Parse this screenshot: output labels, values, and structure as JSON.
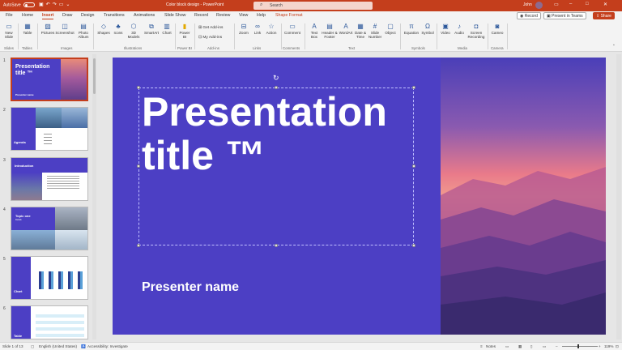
{
  "titlebar": {
    "autosave_label": "AutoSave",
    "autosave_state": "Off",
    "doc_title": "Color block design  -  PowerPoint",
    "search_placeholder": "Search",
    "user_name": "John"
  },
  "tabs": [
    "File",
    "Home",
    "Insert",
    "Draw",
    "Design",
    "Transitions",
    "Animations",
    "Slide Show",
    "Record",
    "Review",
    "View",
    "Help",
    "Shape Format"
  ],
  "active_tab": "Insert",
  "record_label": "Record",
  "present_label": "Present in Teams",
  "share_label": "Share",
  "ribbon": {
    "slides": {
      "new_slide": "New Slide",
      "group": "Slides"
    },
    "tables": {
      "table": "Table",
      "group": "Tables"
    },
    "images": {
      "pictures": "Pictures",
      "screenshot": "Screenshot",
      "photo_album": "Photo Album",
      "group": "Images"
    },
    "illustrations": {
      "shapes": "Shapes",
      "icons": "Icons",
      "models3d": "3D Models",
      "smartart": "SmartArt",
      "chart": "Chart",
      "group": "Illustrations"
    },
    "powerbi": {
      "label": "Power BI",
      "group": "Power BI"
    },
    "addins": {
      "get": "Get Add-ins",
      "my": "My Add-ins",
      "group": "Add-ins"
    },
    "links": {
      "zoom": "Zoom",
      "link": "Link",
      "action": "Action",
      "group": "Links"
    },
    "comments": {
      "comment": "Comment",
      "group": "Comments"
    },
    "text": {
      "textbox": "Text Box",
      "header": "Header & Footer",
      "wordart": "WordArt",
      "datetime": "Date & Time",
      "slidenum": "Slide Number",
      "object": "Object",
      "group": "Text"
    },
    "symbols": {
      "equation": "Equation",
      "symbol": "Symbol",
      "group": "Symbols"
    },
    "media": {
      "video": "Video",
      "audio": "Audio",
      "screen": "Screen Recording",
      "group": "Media"
    },
    "camera": {
      "cameo": "Cameo",
      "group": "Camera"
    }
  },
  "thumbnails": [
    {
      "num": "1",
      "title": "Presentation title ™",
      "sub": "Presenter name"
    },
    {
      "num": "2",
      "title": "Agenda"
    },
    {
      "num": "3",
      "title": "Introduction"
    },
    {
      "num": "4",
      "title": "Topic one",
      "sub": "Details"
    },
    {
      "num": "5",
      "title": "Chart"
    },
    {
      "num": "6",
      "title": "Table"
    }
  ],
  "slide": {
    "title": "Presentation\ntitle ™",
    "presenter": "Presenter name"
  },
  "status": {
    "slide_of": "Slide 1 of 13",
    "language": "English (United States)",
    "accessibility": "Accessibility: Investigate",
    "notes": "Notes",
    "zoom": "119%"
  },
  "colors": {
    "accent": "#c43e1c",
    "slide_bg": "#4c3fc4"
  }
}
